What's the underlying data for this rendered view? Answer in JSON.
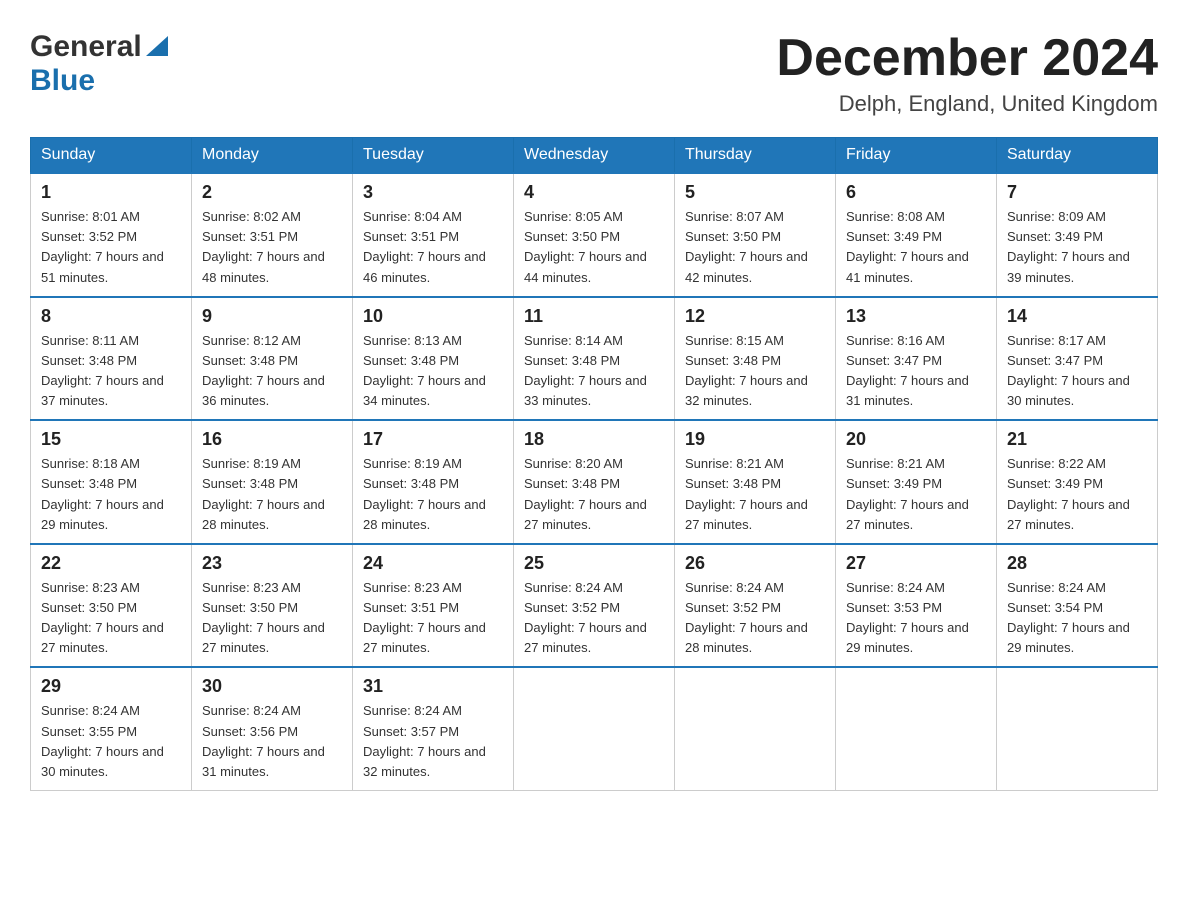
{
  "header": {
    "logo_general": "General",
    "logo_blue": "Blue",
    "month_title": "December 2024",
    "location": "Delph, England, United Kingdom"
  },
  "weekdays": [
    "Sunday",
    "Monday",
    "Tuesday",
    "Wednesday",
    "Thursday",
    "Friday",
    "Saturday"
  ],
  "weeks": [
    [
      {
        "day": "1",
        "sunrise": "8:01 AM",
        "sunset": "3:52 PM",
        "daylight": "7 hours and 51 minutes."
      },
      {
        "day": "2",
        "sunrise": "8:02 AM",
        "sunset": "3:51 PM",
        "daylight": "7 hours and 48 minutes."
      },
      {
        "day": "3",
        "sunrise": "8:04 AM",
        "sunset": "3:51 PM",
        "daylight": "7 hours and 46 minutes."
      },
      {
        "day": "4",
        "sunrise": "8:05 AM",
        "sunset": "3:50 PM",
        "daylight": "7 hours and 44 minutes."
      },
      {
        "day": "5",
        "sunrise": "8:07 AM",
        "sunset": "3:50 PM",
        "daylight": "7 hours and 42 minutes."
      },
      {
        "day": "6",
        "sunrise": "8:08 AM",
        "sunset": "3:49 PM",
        "daylight": "7 hours and 41 minutes."
      },
      {
        "day": "7",
        "sunrise": "8:09 AM",
        "sunset": "3:49 PM",
        "daylight": "7 hours and 39 minutes."
      }
    ],
    [
      {
        "day": "8",
        "sunrise": "8:11 AM",
        "sunset": "3:48 PM",
        "daylight": "7 hours and 37 minutes."
      },
      {
        "day": "9",
        "sunrise": "8:12 AM",
        "sunset": "3:48 PM",
        "daylight": "7 hours and 36 minutes."
      },
      {
        "day": "10",
        "sunrise": "8:13 AM",
        "sunset": "3:48 PM",
        "daylight": "7 hours and 34 minutes."
      },
      {
        "day": "11",
        "sunrise": "8:14 AM",
        "sunset": "3:48 PM",
        "daylight": "7 hours and 33 minutes."
      },
      {
        "day": "12",
        "sunrise": "8:15 AM",
        "sunset": "3:48 PM",
        "daylight": "7 hours and 32 minutes."
      },
      {
        "day": "13",
        "sunrise": "8:16 AM",
        "sunset": "3:47 PM",
        "daylight": "7 hours and 31 minutes."
      },
      {
        "day": "14",
        "sunrise": "8:17 AM",
        "sunset": "3:47 PM",
        "daylight": "7 hours and 30 minutes."
      }
    ],
    [
      {
        "day": "15",
        "sunrise": "8:18 AM",
        "sunset": "3:48 PM",
        "daylight": "7 hours and 29 minutes."
      },
      {
        "day": "16",
        "sunrise": "8:19 AM",
        "sunset": "3:48 PM",
        "daylight": "7 hours and 28 minutes."
      },
      {
        "day": "17",
        "sunrise": "8:19 AM",
        "sunset": "3:48 PM",
        "daylight": "7 hours and 28 minutes."
      },
      {
        "day": "18",
        "sunrise": "8:20 AM",
        "sunset": "3:48 PM",
        "daylight": "7 hours and 27 minutes."
      },
      {
        "day": "19",
        "sunrise": "8:21 AM",
        "sunset": "3:48 PM",
        "daylight": "7 hours and 27 minutes."
      },
      {
        "day": "20",
        "sunrise": "8:21 AM",
        "sunset": "3:49 PM",
        "daylight": "7 hours and 27 minutes."
      },
      {
        "day": "21",
        "sunrise": "8:22 AM",
        "sunset": "3:49 PM",
        "daylight": "7 hours and 27 minutes."
      }
    ],
    [
      {
        "day": "22",
        "sunrise": "8:23 AM",
        "sunset": "3:50 PM",
        "daylight": "7 hours and 27 minutes."
      },
      {
        "day": "23",
        "sunrise": "8:23 AM",
        "sunset": "3:50 PM",
        "daylight": "7 hours and 27 minutes."
      },
      {
        "day": "24",
        "sunrise": "8:23 AM",
        "sunset": "3:51 PM",
        "daylight": "7 hours and 27 minutes."
      },
      {
        "day": "25",
        "sunrise": "8:24 AM",
        "sunset": "3:52 PM",
        "daylight": "7 hours and 27 minutes."
      },
      {
        "day": "26",
        "sunrise": "8:24 AM",
        "sunset": "3:52 PM",
        "daylight": "7 hours and 28 minutes."
      },
      {
        "day": "27",
        "sunrise": "8:24 AM",
        "sunset": "3:53 PM",
        "daylight": "7 hours and 29 minutes."
      },
      {
        "day": "28",
        "sunrise": "8:24 AM",
        "sunset": "3:54 PM",
        "daylight": "7 hours and 29 minutes."
      }
    ],
    [
      {
        "day": "29",
        "sunrise": "8:24 AM",
        "sunset": "3:55 PM",
        "daylight": "7 hours and 30 minutes."
      },
      {
        "day": "30",
        "sunrise": "8:24 AM",
        "sunset": "3:56 PM",
        "daylight": "7 hours and 31 minutes."
      },
      {
        "day": "31",
        "sunrise": "8:24 AM",
        "sunset": "3:57 PM",
        "daylight": "7 hours and 32 minutes."
      },
      null,
      null,
      null,
      null
    ]
  ],
  "labels": {
    "sunrise_prefix": "Sunrise: ",
    "sunset_prefix": "Sunset: ",
    "daylight_prefix": "Daylight: "
  }
}
